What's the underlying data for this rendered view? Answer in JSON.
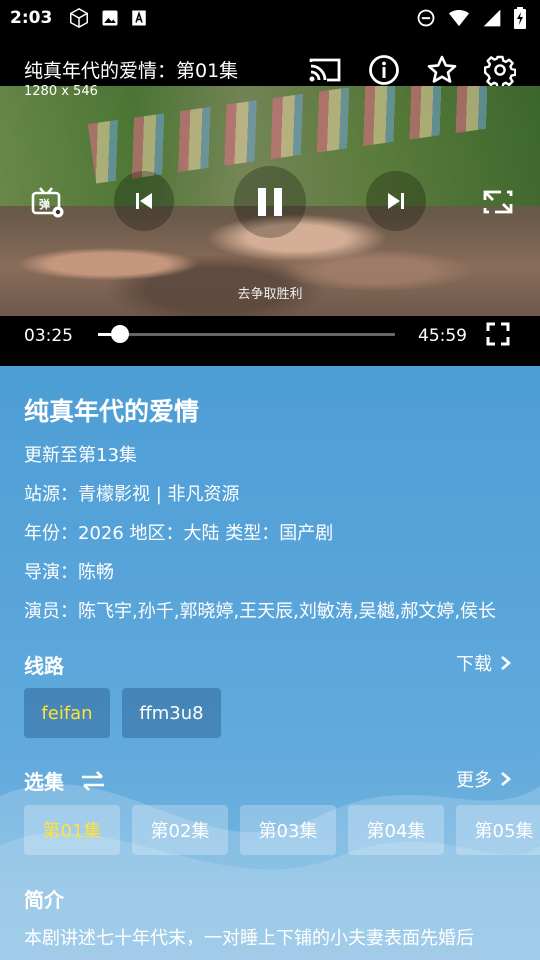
{
  "status_bar": {
    "time": "2:03"
  },
  "player": {
    "title": "纯真年代的爱情：第01集",
    "resolution": "1280 x 546",
    "subtitle": "去争取胜利",
    "current_time": "03:25",
    "total_time": "45:59",
    "progress": 0.074
  },
  "info": {
    "title": "纯真年代的爱情",
    "update": "更新至第13集",
    "source_line": "站源：青檬影视 | 非凡资源",
    "meta_line": "年份：2026  地区：大陆  类型：国产剧",
    "director_line": "导演：陈畅",
    "cast_line": "演员：陈飞宇,孙千,郭晓婷,王天辰,刘敏涛,吴樾,郝文婷,侯长"
  },
  "routes": {
    "label": "线路",
    "download_label": "下载",
    "items": [
      {
        "label": "feifan",
        "selected": true
      },
      {
        "label": "ffm3u8",
        "selected": false
      }
    ]
  },
  "episodes": {
    "label": "选集",
    "more_label": "更多",
    "items": [
      {
        "label": "第01集",
        "selected": true
      },
      {
        "label": "第02集",
        "selected": false
      },
      {
        "label": "第03集",
        "selected": false
      },
      {
        "label": "第04集",
        "selected": false
      },
      {
        "label": "第05集",
        "selected": false
      }
    ]
  },
  "synopsis": {
    "label": "简介",
    "text": "本剧讲述七十年代末，一对睡上下铺的小夫妻表面先婚后"
  },
  "colors": {
    "accent": "#ffe23a",
    "background": "#4a98d2"
  }
}
